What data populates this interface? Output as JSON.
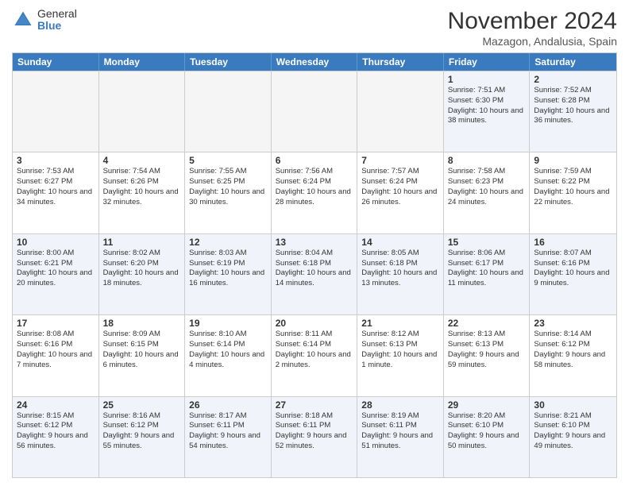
{
  "header": {
    "logo_general": "General",
    "logo_blue": "Blue",
    "month_title": "November 2024",
    "location": "Mazagon, Andalusia, Spain"
  },
  "calendar": {
    "days_of_week": [
      "Sunday",
      "Monday",
      "Tuesday",
      "Wednesday",
      "Thursday",
      "Friday",
      "Saturday"
    ],
    "rows": [
      [
        {
          "day": "",
          "info": "",
          "empty": true
        },
        {
          "day": "",
          "info": "",
          "empty": true
        },
        {
          "day": "",
          "info": "",
          "empty": true
        },
        {
          "day": "",
          "info": "",
          "empty": true
        },
        {
          "day": "",
          "info": "",
          "empty": true
        },
        {
          "day": "1",
          "info": "Sunrise: 7:51 AM\nSunset: 6:30 PM\nDaylight: 10 hours and 38 minutes."
        },
        {
          "day": "2",
          "info": "Sunrise: 7:52 AM\nSunset: 6:28 PM\nDaylight: 10 hours and 36 minutes."
        }
      ],
      [
        {
          "day": "3",
          "info": "Sunrise: 7:53 AM\nSunset: 6:27 PM\nDaylight: 10 hours and 34 minutes."
        },
        {
          "day": "4",
          "info": "Sunrise: 7:54 AM\nSunset: 6:26 PM\nDaylight: 10 hours and 32 minutes."
        },
        {
          "day": "5",
          "info": "Sunrise: 7:55 AM\nSunset: 6:25 PM\nDaylight: 10 hours and 30 minutes."
        },
        {
          "day": "6",
          "info": "Sunrise: 7:56 AM\nSunset: 6:24 PM\nDaylight: 10 hours and 28 minutes."
        },
        {
          "day": "7",
          "info": "Sunrise: 7:57 AM\nSunset: 6:24 PM\nDaylight: 10 hours and 26 minutes."
        },
        {
          "day": "8",
          "info": "Sunrise: 7:58 AM\nSunset: 6:23 PM\nDaylight: 10 hours and 24 minutes."
        },
        {
          "day": "9",
          "info": "Sunrise: 7:59 AM\nSunset: 6:22 PM\nDaylight: 10 hours and 22 minutes."
        }
      ],
      [
        {
          "day": "10",
          "info": "Sunrise: 8:00 AM\nSunset: 6:21 PM\nDaylight: 10 hours and 20 minutes."
        },
        {
          "day": "11",
          "info": "Sunrise: 8:02 AM\nSunset: 6:20 PM\nDaylight: 10 hours and 18 minutes."
        },
        {
          "day": "12",
          "info": "Sunrise: 8:03 AM\nSunset: 6:19 PM\nDaylight: 10 hours and 16 minutes."
        },
        {
          "day": "13",
          "info": "Sunrise: 8:04 AM\nSunset: 6:18 PM\nDaylight: 10 hours and 14 minutes."
        },
        {
          "day": "14",
          "info": "Sunrise: 8:05 AM\nSunset: 6:18 PM\nDaylight: 10 hours and 13 minutes."
        },
        {
          "day": "15",
          "info": "Sunrise: 8:06 AM\nSunset: 6:17 PM\nDaylight: 10 hours and 11 minutes."
        },
        {
          "day": "16",
          "info": "Sunrise: 8:07 AM\nSunset: 6:16 PM\nDaylight: 10 hours and 9 minutes."
        }
      ],
      [
        {
          "day": "17",
          "info": "Sunrise: 8:08 AM\nSunset: 6:16 PM\nDaylight: 10 hours and 7 minutes."
        },
        {
          "day": "18",
          "info": "Sunrise: 8:09 AM\nSunset: 6:15 PM\nDaylight: 10 hours and 6 minutes."
        },
        {
          "day": "19",
          "info": "Sunrise: 8:10 AM\nSunset: 6:14 PM\nDaylight: 10 hours and 4 minutes."
        },
        {
          "day": "20",
          "info": "Sunrise: 8:11 AM\nSunset: 6:14 PM\nDaylight: 10 hours and 2 minutes."
        },
        {
          "day": "21",
          "info": "Sunrise: 8:12 AM\nSunset: 6:13 PM\nDaylight: 10 hours and 1 minute."
        },
        {
          "day": "22",
          "info": "Sunrise: 8:13 AM\nSunset: 6:13 PM\nDaylight: 9 hours and 59 minutes."
        },
        {
          "day": "23",
          "info": "Sunrise: 8:14 AM\nSunset: 6:12 PM\nDaylight: 9 hours and 58 minutes."
        }
      ],
      [
        {
          "day": "24",
          "info": "Sunrise: 8:15 AM\nSunset: 6:12 PM\nDaylight: 9 hours and 56 minutes."
        },
        {
          "day": "25",
          "info": "Sunrise: 8:16 AM\nSunset: 6:12 PM\nDaylight: 9 hours and 55 minutes."
        },
        {
          "day": "26",
          "info": "Sunrise: 8:17 AM\nSunset: 6:11 PM\nDaylight: 9 hours and 54 minutes."
        },
        {
          "day": "27",
          "info": "Sunrise: 8:18 AM\nSunset: 6:11 PM\nDaylight: 9 hours and 52 minutes."
        },
        {
          "day": "28",
          "info": "Sunrise: 8:19 AM\nSunset: 6:11 PM\nDaylight: 9 hours and 51 minutes."
        },
        {
          "day": "29",
          "info": "Sunrise: 8:20 AM\nSunset: 6:10 PM\nDaylight: 9 hours and 50 minutes."
        },
        {
          "day": "30",
          "info": "Sunrise: 8:21 AM\nSunset: 6:10 PM\nDaylight: 9 hours and 49 minutes."
        }
      ]
    ]
  }
}
